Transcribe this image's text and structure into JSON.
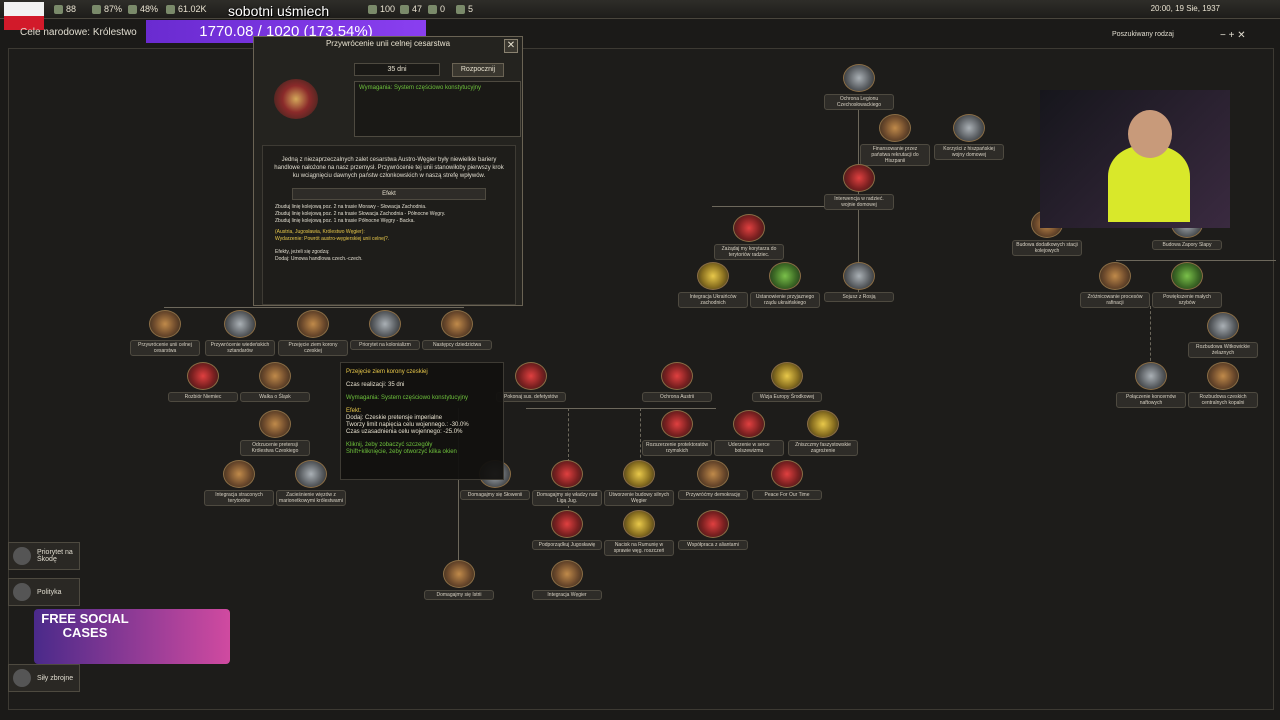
{
  "top": {
    "manpower": "88",
    "stability": "87%",
    "warsupport": "48%",
    "factories": "61.02K",
    "stream_title": "sobotni uśmiech",
    "stream_progress": "1770.08 / 1020 (173.54%)",
    "political_power": "100",
    "stars": "47",
    "conv": "0",
    "special": "5",
    "clock": "20:00, 19 Sie, 1937",
    "goals_label": "Cele narodowe: Królestwo",
    "search_label": "Poszukiwany rodzaj"
  },
  "popup": {
    "title": "Przywrócenie unii celnej cesarstwa",
    "days": "35 dni",
    "start": "Rozpocznij",
    "requirement": "Wymagania: System częściowo konstytucyjny",
    "description": "Jedną z niezaprzeczalnych zalet cesarstwa Austro-Węgier były niewielkie bariery handlowe nałożone na nasz przemysł. Przywrócenie tej unii stanowiłoby pierwszy krok ku wciągnięciu dawnych państw członkowskich w naszą strefę wpływów.",
    "effect_header": "Efekt",
    "effect_lines": [
      "Zbuduj linię kolejową poz. 2 na trasie Morawy - Słowacja Zachodnia.",
      "Zbuduj linię kolejową poz. 2 na trasie Słowacja Zachodnia - Północne Węgry.",
      "Zbuduj linię kolejową poz. 1 na trasie Północne Węgry - Backa.",
      "(Austria, Jugosławia, Królestwo Węgier):",
      "Wydarzenie: Powrót austro-węgierskiej unii celnej?.",
      "Efekty, jeżeli się zgodzą:",
      "Dodaj: Umowa handlowa czech.-czech."
    ]
  },
  "tooltip": {
    "title": "Przejęcie ziem korony czeskiej",
    "time": "Czas realizacji: 35 dni",
    "req": "Wymagania: System częściowo konstytucyjny",
    "effect": "Efekt:",
    "add": "Dodaj: Czeskie pretensje imperialne",
    "tension1": "Tworzy limit napięcia celu wojennego.: -30.0%",
    "tension2": "Czas uzasadnienia celu wojennego: -25.0%",
    "hint1": "Kliknij, żeby zobaczyć szczegóły",
    "hint2": "Shift+kliknięcie, żeby otworzyć kilka okien"
  },
  "focuses": [
    {
      "label": "Przywrócenie unii celnej cesarstwa",
      "color": "brown"
    },
    {
      "label": "Przywrócenie wiedeńskich sztandarów",
      "color": "grey"
    },
    {
      "label": "Przejęcie ziem korony czeskiej",
      "color": "brown"
    },
    {
      "label": "Priorytet na kolonializm",
      "color": "grey"
    },
    {
      "label": "Następcy dziedzictwa",
      "color": "brown"
    },
    {
      "label": "Rozbiór Niemiec",
      "color": "red"
    },
    {
      "label": "Walka o Śląsk",
      "color": "brown"
    },
    {
      "label": "Odrzucenie pretensji Królestwa Czeskiego",
      "color": "brown"
    },
    {
      "label": "Integracja straconych terytoriów",
      "color": "brown"
    },
    {
      "label": "Zacieśnienie więzów z marionetkowymi królestwami",
      "color": "grey"
    },
    {
      "label": "Pokonaj sus. defetystów",
      "color": "red"
    },
    {
      "label": "Ochrona Austrii",
      "color": "red"
    },
    {
      "label": "Wizja Europy Środkowej",
      "color": "yellow"
    },
    {
      "label": "Rozszerzenie protektoratów rzymskich",
      "color": "red"
    },
    {
      "label": "Uderzenie w serce bolszewizmu",
      "color": "red"
    },
    {
      "label": "Zniszczmy faszystowskie zagrożenie",
      "color": "yellow"
    },
    {
      "label": "Domagajmy się Słowenii",
      "color": "grey"
    },
    {
      "label": "Domagajmy się władzy nad Ligą Jug.",
      "color": "red"
    },
    {
      "label": "Utworzenie budowy silnych Węgier",
      "color": "yellow"
    },
    {
      "label": "Przywróćmy demokrację",
      "color": "brown"
    },
    {
      "label": "Peace For Our Time",
      "color": "red"
    },
    {
      "label": "Podporządkuj Jugosławię",
      "color": "red"
    },
    {
      "label": "Nacisk na Rumunię w sprawie węg. roszczeń",
      "color": "yellow"
    },
    {
      "label": "Współpraca z aliantami",
      "color": "red"
    },
    {
      "label": "Domagajmy się Istrii",
      "color": "brown"
    },
    {
      "label": "Integracja Węgier",
      "color": "brown"
    },
    {
      "label": "Ochrona Legionu Czechosłowackiego",
      "color": "grey"
    },
    {
      "label": "Finansowanie przez państwa rekrutacji do Hiszpanii",
      "color": "brown"
    },
    {
      "label": "Korzyści z hiszpańskiej wojny domowej",
      "color": "grey"
    },
    {
      "label": "Interwencja w radzieć. wojnie domowej",
      "color": "red"
    },
    {
      "label": "Zażądaj my korytarza do terytoriów radziec.",
      "color": "red"
    },
    {
      "label": "Integracja Ukraińców zachodnich",
      "color": "yellow"
    },
    {
      "label": "Ustanowienie przyjaznego rządu ukraińskiego",
      "color": "green"
    },
    {
      "label": "Sojusz z Rosją",
      "color": "grey"
    },
    {
      "label": "Budowa dodatkowych stacji kolejowych",
      "color": "brown"
    },
    {
      "label": "Budowa Zapory Slapy",
      "color": "grey"
    },
    {
      "label": "Zróżnicowanie procesów rafinacji",
      "color": "brown"
    },
    {
      "label": "Powiększenie małych szybów",
      "color": "green"
    },
    {
      "label": "Rozbudowa Witkowickie żelaznych",
      "color": "grey"
    },
    {
      "label": "Połączenie koncernów naftowych",
      "color": "grey"
    },
    {
      "label": "Rozbudowa czeskich centralnych kopalni",
      "color": "brown"
    }
  ],
  "side": {
    "priority": "Priorytet na Škodę",
    "politics": "Polityka",
    "forces": "Siły zbrojne"
  },
  "promo": {
    "text": "FREE SOCIAL CASES"
  }
}
